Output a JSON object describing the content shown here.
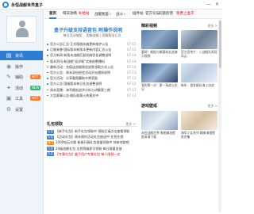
{
  "window": {
    "title": "永恒战舰世界盒子",
    "minimize_glyph": "—",
    "close_glyph": "✕"
  },
  "sidebar": {
    "items": [
      {
        "label": "资讯",
        "icon": "list-icon",
        "glyph": "▤",
        "active": true
      },
      {
        "label": "操作",
        "icon": "controller-icon",
        "glyph": "◉"
      },
      {
        "label": "辅助",
        "icon": "wrench-icon",
        "glyph": "✎",
        "badge": "HOT"
      },
      {
        "label": "活动",
        "icon": "gift-icon",
        "glyph": "✦",
        "badge": "NEW"
      },
      {
        "label": "工具",
        "icon": "toolbox-icon",
        "glyph": "▣",
        "badge": "HOT"
      },
      {
        "label": "设置",
        "icon": "gear-icon",
        "glyph": "⚙"
      }
    ]
  },
  "tabs": [
    {
      "label": "首页",
      "active": true
    },
    {
      "label": "每日攻略"
    },
    {
      "label": "补给站",
      "red": true
    },
    {
      "label": "战舰图鉴",
      "caret": true
    },
    {
      "label": "战斗",
      "caret": true
    },
    {
      "label": "插件站"
    },
    {
      "label": "官方论坛"
    },
    {
      "label": "问题反馈"
    },
    {
      "label": "免费上盒子",
      "red": true
    }
  ],
  "banner": {
    "title": "盒子升级支持语音包 附操作说明",
    "links": [
      "每日活动抽奖",
      "国服战报 | 国服版本汇总"
    ]
  },
  "news": [
    {
      "text": "官方公告汇总·正式版服务器更新维护公告",
      "date": "07-15"
    },
    {
      "text": "巨舰来袭·国际版本新版本更新内容汇总公告",
      "date": "07-15"
    },
    {
      "text": "官方新闻·新版本战舰匹配机制优化调整说明",
      "date": "07-14"
    },
    {
      "text": "版本资讯·新战舰\"巡洋舰\"实装前瞻爆料",
      "date": "07-14"
    },
    {
      "text": "最新活动：充值送战舰限定皮肤领取方式公告",
      "date": "07-14"
    },
    {
      "text": "官方公告：周末双倍经验活动开启通知说明",
      "date": "07-13"
    },
    {
      "text": "官方活动：分享截图赢取丰厚奖励",
      "date": "07-13"
    },
    {
      "text": "官方公告·国服版本每日任务调整说明",
      "date": "07-12"
    },
    {
      "text": "周末直播：海军舰船战术分析与讲解第三期",
      "date": "07-11"
    },
    {
      "text": "大型赛事公告·舰队联赛火热报名中",
      "date": "07-11"
    }
  ],
  "gifts": {
    "title": "礼包领取",
    "more": "更多 >",
    "items": [
      {
        "tag": "礼包",
        "text": "【新手礼包】新手礼包领取中 领取后请点击查看领取"
      },
      {
        "tag": "礼包",
        "text": "【活动礼包】周末限时活动礼包放送中 先到先得"
      },
      {
        "tag": "热门",
        "text": "2000钻石兑换 新服开服礼包限量领取中 快来领取吧"
      },
      {
        "tag": "礼包",
        "text": "20级战舰礼包 达到等级即可领取 每日限量发放"
      },
      {
        "tag": "礼包",
        "text": "【专属礼包】盒子用户专属礼包 每人限领一次",
        "red": true
      }
    ]
  },
  "screenshots": {
    "title": "精彩视频",
    "more": "更多 >",
    "items": [
      {
        "caption": "重磅！舰船与舰载机实战演示视频",
        "img": "img-a"
      },
      {
        "caption": "官方宣传片：二战舰队再现风云",
        "img": "img-b"
      },
      {
        "caption": "我的第一次：第一场战斗实况",
        "img": "img-c"
      },
      {
        "caption": "新年：首发舰队海上决战",
        "img": "img-d"
      }
    ]
  },
  "wallpapers": {
    "title": "游戏壁纸",
    "more": "更多 >",
    "items": [
      {
        "caption": "永恒战舰世界 美图精选壁纸高清下载",
        "img": "img-e"
      },
      {
        "caption": "海军少女系列 精美海报壁纸合集",
        "img": "img-f"
      }
    ]
  }
}
